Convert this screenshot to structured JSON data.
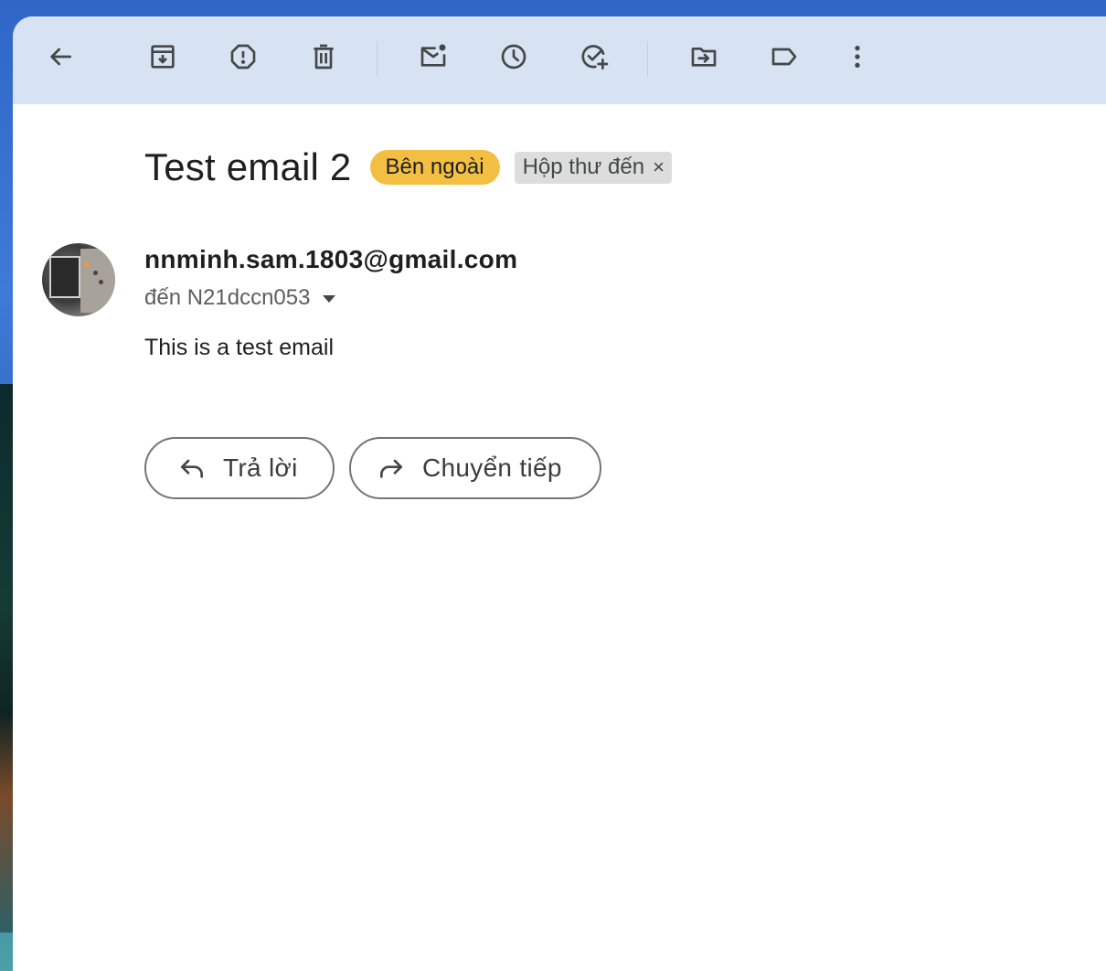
{
  "toolbar": {
    "buttons": [
      {
        "name": "back-arrow-icon"
      },
      {
        "name": "archive-icon"
      },
      {
        "name": "report-spam-icon"
      },
      {
        "name": "delete-icon"
      },
      {
        "name": "mark-unread-icon"
      },
      {
        "name": "snooze-icon"
      },
      {
        "name": "add-to-tasks-icon"
      },
      {
        "name": "move-to-icon"
      },
      {
        "name": "label-icon"
      },
      {
        "name": "more-options-icon"
      }
    ]
  },
  "email": {
    "subject": "Test email 2",
    "external_chip": "Bên ngoài",
    "inbox_chip": "Hộp thư đến",
    "inbox_chip_close": "×",
    "sender": "nnminh.sam.1803@gmail.com",
    "recipient": "đến N21dccn053",
    "body": "This is a test email"
  },
  "actions": {
    "reply": "Trả lời",
    "forward": "Chuyển tiếp"
  },
  "colors": {
    "toolbar_bg": "#d7e2f3",
    "external_chip_bg": "#f2bf42",
    "inbox_chip_bg": "#dddddd",
    "icon": "#444746"
  }
}
